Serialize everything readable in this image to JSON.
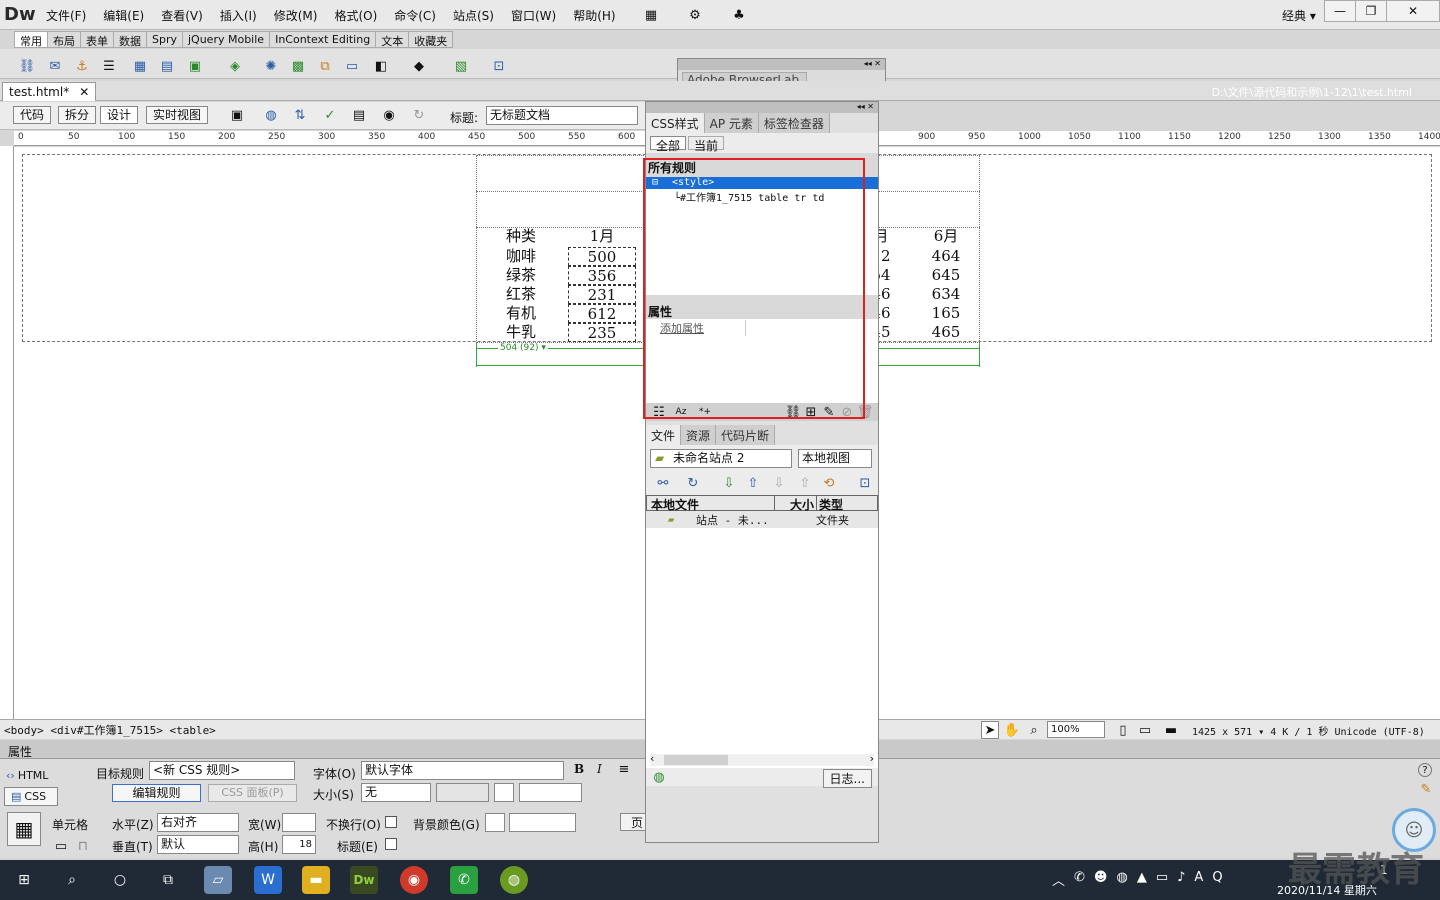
{
  "app": {
    "logo": "Dw",
    "workspace": "经典 ▾"
  },
  "menu": [
    "文件(F)",
    "编辑(E)",
    "查看(V)",
    "插入(I)",
    "修改(M)",
    "格式(O)",
    "命令(C)",
    "站点(S)",
    "窗口(W)",
    "帮助(H)"
  ],
  "window_buttons": [
    "—",
    "❐",
    "✕"
  ],
  "insert_tabs": [
    "常用",
    "布局",
    "表单",
    "数据",
    "Spry",
    "jQuery Mobile",
    "InContext Editing",
    "文本",
    "收藏夹"
  ],
  "document": {
    "tab_name": "test.html*",
    "tab_close": "✕",
    "path": "D:\\文件\\源代码和示例\\1-12\\1\\test.html",
    "title_label": "标题:",
    "title_value": "无标题文档"
  },
  "view_buttons": [
    "代码",
    "拆分",
    "设计",
    "实时视图"
  ],
  "ruler_marks": [
    "0",
    "50",
    "100",
    "150",
    "200",
    "250",
    "300",
    "350",
    "400",
    "450",
    "500",
    "550",
    "600",
    "900",
    "950",
    "1000",
    "1050",
    "1100",
    "1150",
    "1200",
    "1250",
    "1300",
    "1350",
    "1400"
  ],
  "table": {
    "headers": [
      "种类",
      "1月",
      "月",
      "6月"
    ],
    "rows": [
      {
        "name": "咖啡",
        "jan": "500",
        "may": "12",
        "jun": "464"
      },
      {
        "name": "绿茶",
        "jan": "356",
        "may": "54",
        "jun": "645"
      },
      {
        "name": "红茶",
        "jan": "231",
        "may": "46",
        "jun": "634"
      },
      {
        "name": "有机",
        "jan": "612",
        "may": "46",
        "jun": "165"
      },
      {
        "name": "牛乳",
        "jan": "235",
        "may": "45",
        "jun": "465"
      }
    ],
    "width_label": "504 (92) ▾"
  },
  "browserlab": {
    "title": "Adobe BrowserLab"
  },
  "css_panel": {
    "tabs": [
      "CSS样式",
      "AP 元素",
      "标签检查器"
    ],
    "mode_tabs": [
      "全部",
      "当前"
    ],
    "all_rules_title": "所有规则",
    "style_node": "<style>",
    "rule_node": "#工作簿1_7515 table tr td",
    "props_title": "属性",
    "add_property": "添加属性"
  },
  "files_panel": {
    "tabs": [
      "文件",
      "资源",
      "代码片断"
    ],
    "site": "未命名站点 2",
    "view": "本地视图",
    "columns": [
      "本地文件",
      "大小",
      "类型"
    ],
    "row_name": "站点 - 未...",
    "row_type": "文件夹",
    "log_button": "日志..."
  },
  "status": {
    "tags": "<body> <div#工作簿1_7515> <table>",
    "zoom": "100%",
    "info": "1425 x 571 ▾  4 K / 1 秒  Unicode (UTF-8)"
  },
  "properties": {
    "title": "属性",
    "html_btn": "HTML",
    "css_btn": "CSS",
    "target_rule_label": "目标规则",
    "target_rule_value": "<新 CSS 规则>",
    "edit_rule_btn": "编辑规则",
    "css_panel_btn": "CSS 面板(P)",
    "font_label": "字体(O)",
    "font_value": "默认字体",
    "size_label": "大小(S)",
    "size_value": "无",
    "bold": "B",
    "italic": "I",
    "cell_label": "单元格",
    "horz_label": "水平(Z)",
    "horz_value": "右对齐",
    "vert_label": "垂直(T)",
    "vert_value": "默认",
    "width_label": "宽(W)",
    "height_label": "高(H)",
    "height_value": "18",
    "nowrap_label": "不换行(O)",
    "header_label": "标题(E)",
    "bgcolor_label": "背景颜色(G)",
    "page_btn": "页"
  },
  "taskbar": {
    "time": "1",
    "date": "2020/11/14 星期六",
    "ime": "A"
  },
  "watermark": "最需教育",
  "colors": {
    "highlight": "#e02020",
    "selection": "#1a6ed8",
    "taskbar": "#1f2a36"
  }
}
